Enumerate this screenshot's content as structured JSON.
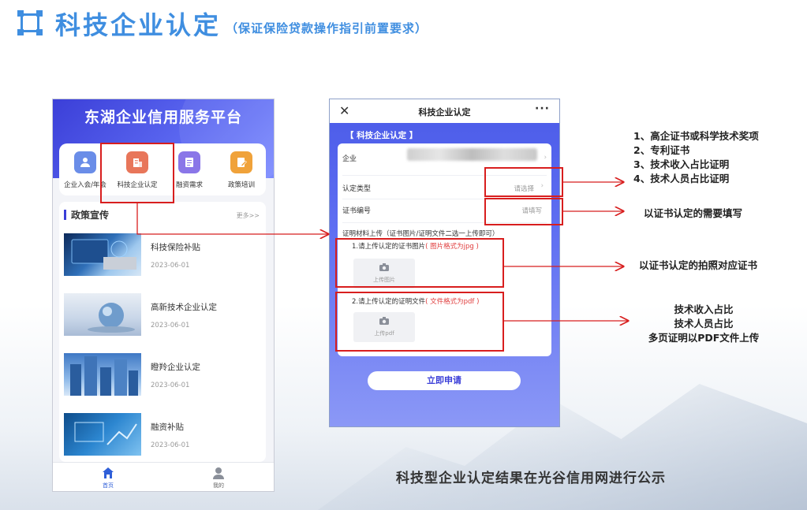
{
  "header": {
    "title": "科技企业认定",
    "subtitle": "（保证保险贷款操作指引前置要求）"
  },
  "phone_home": {
    "title": "东湖企业信用服务平台",
    "menu": [
      {
        "label": "企业入会/年会",
        "icon": "user-icon",
        "color": "#6a8de8"
      },
      {
        "label": "科技企业认定",
        "icon": "building-icon",
        "color": "#e8765a"
      },
      {
        "label": "融资需求",
        "icon": "document-icon",
        "color": "#8a76e8"
      },
      {
        "label": "政策培训",
        "icon": "edit-icon",
        "color": "#f0a23a"
      }
    ],
    "policy": {
      "title": "政策宣传",
      "more": "更多>>",
      "news": [
        {
          "title": "科技保险补贴",
          "date": "2023-06-01"
        },
        {
          "title": "高新技术企业认定",
          "date": "2023-06-01"
        },
        {
          "title": "瞪羚企业认定",
          "date": "2023-06-01"
        },
        {
          "title": "融资补贴",
          "date": "2023-06-01"
        }
      ]
    },
    "tabs": [
      {
        "label": "首页",
        "icon": "home-icon"
      },
      {
        "label": "我的",
        "icon": "person-icon"
      }
    ]
  },
  "phone_form": {
    "close": "✕",
    "title": "科技企业认定",
    "more": "···",
    "section": "【 科技企业认定 】",
    "rows": {
      "company_label": "企业",
      "type_label": "认定类型",
      "type_placeholder": "请选择",
      "cert_label": "证书编号",
      "cert_placeholder": "请填写",
      "material_label": "证明材料上传（证书图片/证明文件二选一上传即可）"
    },
    "upload_image": {
      "label": "1.请上传认定的证书图片",
      "note": "( 图片格式为jpg )",
      "button": "上传图片"
    },
    "upload_pdf": {
      "label": "2.请上传认定的证明文件",
      "note": "( 文件格式为pdf )",
      "button": "上传pdf"
    },
    "submit": "立即申请"
  },
  "annotations": {
    "type_list": [
      "1、高企证书或科学技术奖项",
      "2、专利证书",
      "3、技术收入占比证明",
      "4、技术人员占比证明"
    ],
    "cert_note": "以证书认定的需要填写",
    "image_note": "以证书认定的拍照对应证书",
    "pdf_note": [
      "技术收入占比",
      "技术人员占比",
      "多页证明以PDF文件上传"
    ],
    "bottom_note": "科技型企业认定结果在光谷信用网进行公示"
  }
}
